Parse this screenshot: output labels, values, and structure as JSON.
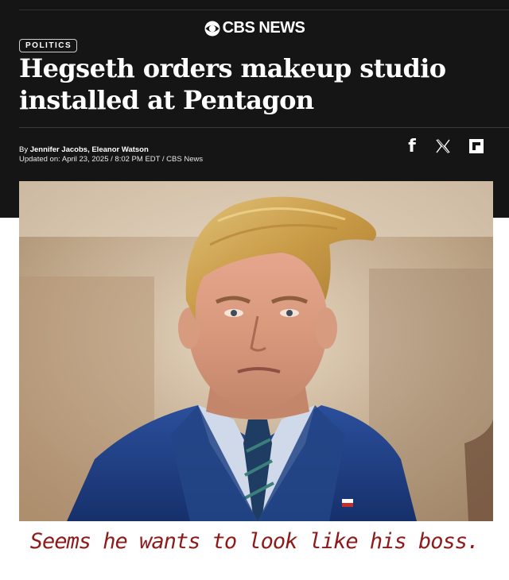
{
  "brand": "CBS NEWS",
  "category_badge": "POLITICS",
  "headline": "Hegseth orders makeup studio installed at Pentagon",
  "byline": {
    "prefix": "By",
    "authors": "Jennifer Jacobs, Eleanor Watson",
    "updated": "Updated on: April 23, 2025 / 8:02 PM EDT / CBS News"
  },
  "share": {
    "facebook": "f",
    "icons": [
      "facebook-icon",
      "x-icon",
      "flipboard-icon"
    ]
  },
  "photo": {
    "subject": "man-in-blue-suit-portrait"
  },
  "caption": "Seems he wants to look like his boss.",
  "colors": {
    "header_bg": "#151515",
    "caption": "#8e1a1a",
    "suit": "#1f3f86"
  }
}
